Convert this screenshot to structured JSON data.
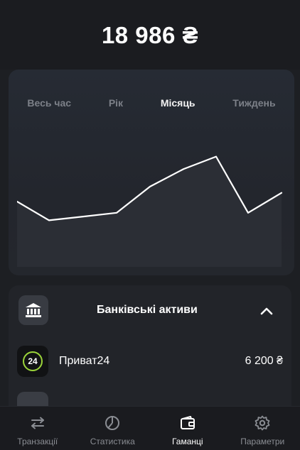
{
  "header": {
    "balance": "18 986 ₴"
  },
  "period_tabs": [
    {
      "label": "Весь час",
      "active": false
    },
    {
      "label": "Рік",
      "active": false
    },
    {
      "label": "Місяць",
      "active": true
    },
    {
      "label": "Тиждень",
      "active": false
    }
  ],
  "chart_data": {
    "type": "area",
    "x": [
      0,
      1,
      2,
      3,
      4,
      5,
      6,
      7,
      8,
      9
    ],
    "series": [
      {
        "values": [
          50,
          35,
          38,
          41,
          62,
          76,
          86,
          41,
          57
        ]
      }
    ],
    "ylim": [
      0,
      100
    ],
    "grid": false,
    "colors": {
      "line": "#ffffff",
      "fill": "#2b2e35"
    }
  },
  "bank_section": {
    "title": "Банківські активи",
    "icon": "bank-icon",
    "collapse_icon": "chevron-up-icon",
    "accounts": [
      {
        "icon_text": "24",
        "name": "Приват24",
        "amount": "6 200 ₴",
        "icon_color": "#9bd43a"
      }
    ]
  },
  "nav": {
    "items": [
      {
        "label": "Транзакції",
        "icon": "transfer-arrows-icon",
        "active": false
      },
      {
        "label": "Статистика",
        "icon": "pie-chart-icon",
        "active": false
      },
      {
        "label": "Гаманці",
        "icon": "wallet-icon",
        "active": true
      },
      {
        "label": "Параметри",
        "icon": "gear-icon",
        "active": false
      }
    ]
  }
}
